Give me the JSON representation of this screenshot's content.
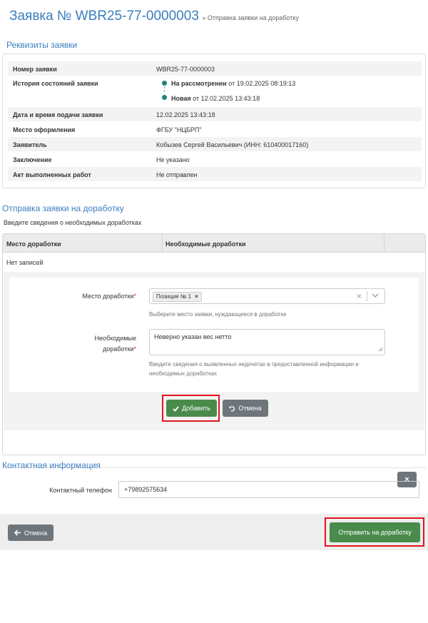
{
  "header": {
    "title": "Заявка № WBR25-77-0000003",
    "breadcrumb": "» Отправка заявки на доработку"
  },
  "requisites": {
    "title": "Реквизиты заявки",
    "rows": [
      {
        "label": "Номер заявки",
        "value": "WBR25-77-0000003"
      },
      {
        "label": "История состояний заявки"
      },
      {
        "label": "Дата и время подачи заявки",
        "value": "12.02.2025 13:43:18"
      },
      {
        "label": "Место оформления",
        "value": "ФГБУ \"НЦБРП\""
      },
      {
        "label": "Заявитель",
        "value": "Кобызев Сергей Васильевич (ИНН: 610400017160)"
      },
      {
        "label": "Заключение",
        "value": "Не указано"
      },
      {
        "label": "Акт выполненных работ",
        "value": "Не отправлен"
      }
    ],
    "history": [
      {
        "status": "На рассмотрении",
        "date": "от 19.02.2025 08:19:13"
      },
      {
        "status": "Новая",
        "date": "от 12.02.2025 13:43:18"
      }
    ]
  },
  "rework": {
    "title": "Отправка заявки на доработку",
    "description": "Введите сведения о необходимых доработках",
    "columns": [
      "Место доработки",
      "Необходимые доработки"
    ],
    "empty_text": "Нет записей",
    "form": {
      "place_label": "Место доработки",
      "place_tag": "Позиция № 1",
      "place_hint": "Выберите место заявки, нуждающееся в доработке",
      "needs_label_line1": "Необходимые",
      "needs_label_line2": "доработки",
      "needs_value": "Неверно указан вес нетто",
      "needs_hint_line1": "Введите сведения о выявленных недочетах в предоставленной информации и",
      "needs_hint_line2": "необходимых доработках",
      "required_mark": "*",
      "add_button": "Добавить",
      "cancel_button": "Отмена"
    }
  },
  "contact": {
    "title": "Контактная информация",
    "phone_label": "Контактный телефон",
    "phone_value": "+79892575634"
  },
  "footer": {
    "back_button": "Отмена",
    "submit_button": "Отправить на доработку"
  },
  "colors": {
    "accent": "#3a7ebf",
    "success": "#4a8b4c",
    "secondary": "#6e757b",
    "highlight": "#e0141e",
    "status_dot": "#1f8376"
  }
}
